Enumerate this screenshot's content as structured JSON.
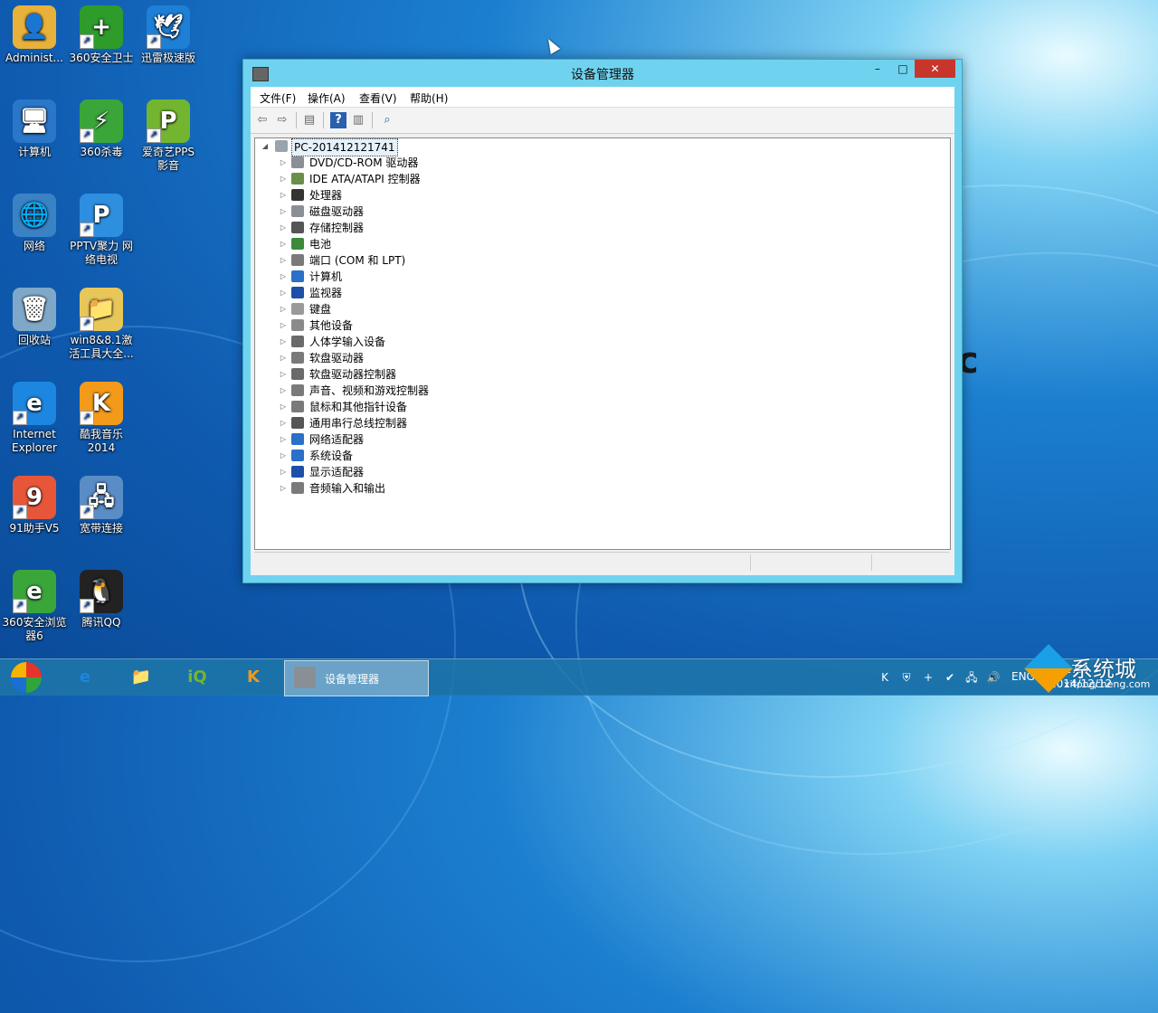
{
  "desktop": {
    "icons": [
      {
        "label": "Administ...",
        "glyph": "👤",
        "color": "#e8b13a"
      },
      {
        "label": "360安全卫士",
        "glyph": "+",
        "color": "#2e9c2a"
      },
      {
        "label": "迅雷极速版",
        "glyph": "🕊",
        "color": "#1e7fd6"
      },
      {
        "label": "计算机",
        "glyph": "🖥",
        "color": "#2a76c8"
      },
      {
        "label": "360杀毒",
        "glyph": "⚡",
        "color": "#3aa63a"
      },
      {
        "label": "爱奇艺PPS\n影音",
        "glyph": "P",
        "color": "#73b52e"
      },
      {
        "label": "网络",
        "glyph": "🌐",
        "color": "#3b82c4"
      },
      {
        "label": "PPTV聚力 网\n络电视",
        "glyph": "P",
        "color": "#2e8fe0"
      },
      {
        "label": "回收站",
        "glyph": "🗑",
        "color": "#7fa8c8"
      },
      {
        "label": "win8&8.1激\n活工具大全...",
        "glyph": "📁",
        "color": "#e8c75a"
      },
      {
        "label": "Internet\nExplorer",
        "glyph": "e",
        "color": "#1c86e0"
      },
      {
        "label": "酷我音乐\n2014",
        "glyph": "K",
        "color": "#f39a1a"
      },
      {
        "label": "91助手V5",
        "glyph": "9",
        "color": "#e8563a"
      },
      {
        "label": "宽带连接",
        "glyph": "🖧",
        "color": "#5a8cc6"
      },
      {
        "label": "360安全浏览\n器6",
        "glyph": "e",
        "color": "#3aa63a"
      },
      {
        "label": "腾讯QQ",
        "glyph": "🐧",
        "color": "#222222"
      }
    ],
    "edge_text": "c"
  },
  "window": {
    "title": "设备管理器",
    "buttons": {
      "minimize": "–",
      "maximize": "□",
      "close": "✕"
    },
    "menu": [
      "文件(F)",
      "操作(A)",
      "查看(V)",
      "帮助(H)"
    ],
    "toolbar": [
      {
        "name": "back-icon",
        "glyph": "⇦"
      },
      {
        "name": "forward-icon",
        "glyph": "⇨"
      },
      {
        "name": "properties-grid-icon",
        "glyph": "▤"
      },
      {
        "name": "help-icon",
        "glyph": "?"
      },
      {
        "name": "view-pane-icon",
        "glyph": "▥"
      },
      {
        "name": "scan-hardware-icon",
        "glyph": "⌕"
      }
    ],
    "tree": {
      "root": "PC-201412121741",
      "items": [
        {
          "label": "DVD/CD-ROM 驱动器",
          "icon": "optical-drive-icon",
          "color": "#8a8f96"
        },
        {
          "label": "IDE ATA/ATAPI 控制器",
          "icon": "ide-controller-icon",
          "color": "#6b8f4a"
        },
        {
          "label": "处理器",
          "icon": "processor-icon",
          "color": "#333333"
        },
        {
          "label": "磁盘驱动器",
          "icon": "disk-drive-icon",
          "color": "#8a8f96"
        },
        {
          "label": "存储控制器",
          "icon": "storage-controller-icon",
          "color": "#555555"
        },
        {
          "label": "电池",
          "icon": "battery-icon",
          "color": "#3a8a3a"
        },
        {
          "label": "端口 (COM 和 LPT)",
          "icon": "port-icon",
          "color": "#7a7a7a"
        },
        {
          "label": "计算机",
          "icon": "computer-icon",
          "color": "#2a6fc8"
        },
        {
          "label": "监视器",
          "icon": "monitor-icon",
          "color": "#1c4fa8"
        },
        {
          "label": "键盘",
          "icon": "keyboard-icon",
          "color": "#9a9a9a"
        },
        {
          "label": "其他设备",
          "icon": "other-devices-icon",
          "color": "#8a8a8a"
        },
        {
          "label": "人体学输入设备",
          "icon": "hid-icon",
          "color": "#6a6a6a"
        },
        {
          "label": "软盘驱动器",
          "icon": "floppy-drive-icon",
          "color": "#7a7a7a"
        },
        {
          "label": "软盘驱动器控制器",
          "icon": "floppy-controller-icon",
          "color": "#6a6a6a"
        },
        {
          "label": "声音、视频和游戏控制器",
          "icon": "sound-icon",
          "color": "#7a7a7a"
        },
        {
          "label": "鼠标和其他指针设备",
          "icon": "mouse-icon",
          "color": "#7a7a7a"
        },
        {
          "label": "通用串行总线控制器",
          "icon": "usb-icon",
          "color": "#555555"
        },
        {
          "label": "网络适配器",
          "icon": "network-adapter-icon",
          "color": "#2a6fc8"
        },
        {
          "label": "系统设备",
          "icon": "system-devices-icon",
          "color": "#2a6fc8"
        },
        {
          "label": "显示适配器",
          "icon": "display-adapter-icon",
          "color": "#1c4fa8"
        },
        {
          "label": "音频输入和输出",
          "icon": "audio-io-icon",
          "color": "#7a7a7a"
        }
      ]
    }
  },
  "taskbar": {
    "pinned": [
      {
        "name": "ie-pin",
        "glyph": "e",
        "color": "#1c86e0"
      },
      {
        "name": "explorer-pin",
        "glyph": "📁",
        "color": "#e8c75a"
      },
      {
        "name": "iqiyi-pin",
        "glyph": "iQ",
        "color": "#73b52e"
      },
      {
        "name": "kuwo-pin",
        "glyph": "K",
        "color": "#f39a1a"
      }
    ],
    "active_task": "设备管理器",
    "tray": [
      "kuwo-tray-icon",
      "360-shield-tray-icon",
      "360-tray-icon",
      "security-tray-icon",
      "network-tray-icon",
      "volume-tray-icon"
    ],
    "tray_glyphs": [
      "K",
      "⛨",
      "+",
      "✔",
      "🖧",
      "🔊"
    ],
    "lang": "ENG",
    "time": "17:4",
    "date": "2014/12/12"
  },
  "watermark": {
    "text": "系统城",
    "url": "xitongcheng.com"
  }
}
